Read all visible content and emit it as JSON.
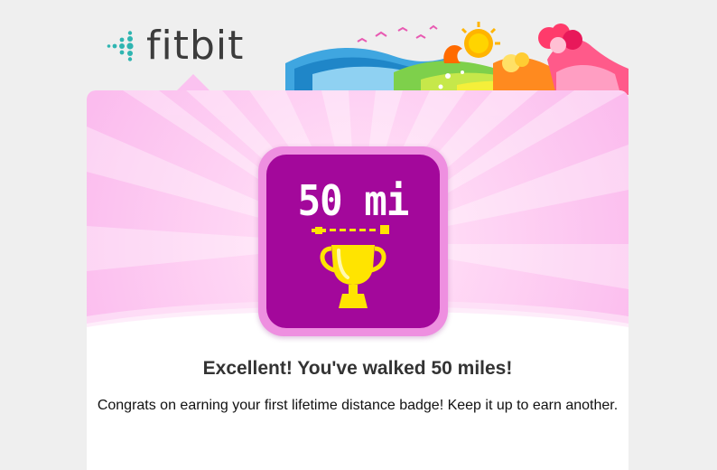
{
  "header": {
    "logo_text": "fitbit",
    "logo_icon": "fitbit-dots-icon",
    "decoration": "colorful-landscape-illustration"
  },
  "badge": {
    "label": "50 mi",
    "icon": "trophy-icon",
    "colors": {
      "outer": "#ee8fe0",
      "inner": "#a3089b",
      "trophy": "#ffe400"
    }
  },
  "message": {
    "title": "Excellent! You've walked 50 miles!",
    "body": "Congrats on earning your first lifetime distance badge! Keep it up to earn another."
  },
  "colors": {
    "page_background": "#efefef",
    "card_pink": "#fbc2f0",
    "logo_teal": "#2fb5b1"
  }
}
